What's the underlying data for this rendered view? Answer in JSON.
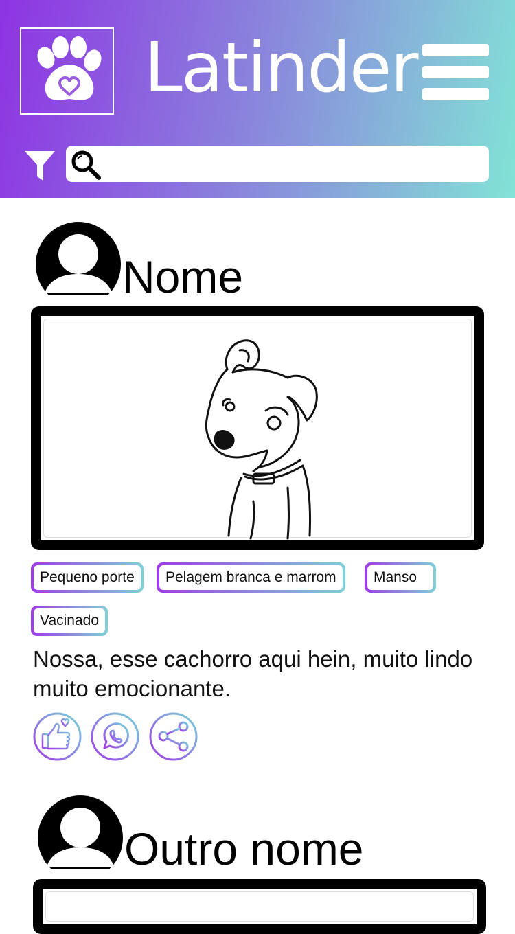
{
  "header": {
    "app_title": "Latinder",
    "logo_icon": "paw-heart-icon",
    "menu_icon": "hamburger-menu-icon",
    "filter_icon": "filter-funnel-icon",
    "search": {
      "icon": "search-icon",
      "value": "",
      "placeholder": ""
    }
  },
  "colors": {
    "gradient_start": "#8e33e3",
    "gradient_end": "#82e3d6",
    "tag_border_start": "#9e3be6",
    "tag_border_end": "#7fd0d6"
  },
  "posts": [
    {
      "name": "Nome",
      "avatar_icon": "user-avatar-icon",
      "photo": "dog-sketch-illustration",
      "tags": [
        "Pequeno porte",
        "Pelagem branca e marrom",
        "Manso",
        "Vacinado"
      ],
      "description": "Nossa, esse cachorro aqui hein, muito lindo muito emocionante.",
      "actions": [
        {
          "name": "like",
          "icon": "thumbs-up-heart-icon"
        },
        {
          "name": "whatsapp",
          "icon": "whatsapp-icon"
        },
        {
          "name": "share",
          "icon": "share-icon"
        }
      ]
    },
    {
      "name": "Outro nome",
      "avatar_icon": "user-avatar-icon"
    }
  ]
}
